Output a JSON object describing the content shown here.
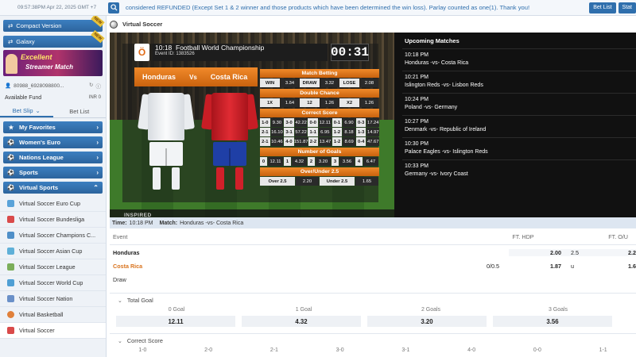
{
  "topbar": {
    "datetime": "09:57:38PM Apr 22, 2025 GMT +7",
    "announcement": "considered REFUNDED (Except Set 1 & 2 winner and those products which have been determined the win loss). Parlay counted as one(1). Thank you!",
    "bet_list_label": "Bet List",
    "stat_label": "Stat"
  },
  "sidebar": {
    "compact_label": "Compact Version",
    "new_badge": "NEW",
    "galaxy_label": "Galaxy",
    "banner_line1": "Excellent",
    "banner_line2": "Streamer Match",
    "account_id": "80988_6928098800...",
    "fund_label": "Available Fund",
    "fund_value": "INR 0",
    "tabs": [
      "Bet Slip",
      "Bet List"
    ],
    "categories": [
      {
        "label": "My Favorites",
        "icon": "star-icon"
      },
      {
        "label": "Women's Euro",
        "icon": "soccer-ball-icon"
      },
      {
        "label": "Nations League",
        "icon": "soccer-ball-icon"
      },
      {
        "label": "Sports",
        "icon": "soccer-ball-icon"
      },
      {
        "label": "Virtual Sports",
        "icon": "soccer-ball-icon"
      }
    ],
    "virtual_items": [
      "Virtual Soccer Euro Cup",
      "Virtual Soccer Bundesliga",
      "Virtual Soccer Champions C...",
      "Virtual Soccer Asian Cup",
      "Virtual Soccer League",
      "Virtual Soccer World Cup",
      "Virtual Soccer Nation",
      "Virtual Basketball",
      "Virtual Soccer"
    ]
  },
  "main": {
    "title": "Virtual Soccer",
    "board": {
      "logo": "Ö",
      "time": "10:18",
      "competition": "Football World Championship",
      "event_id": "Event ID: 1383526",
      "countdown": "00:31",
      "home": "Honduras",
      "vs": "Vs",
      "away": "Costa Rica",
      "inspired": "INSPIRED"
    },
    "match_betting": {
      "title": "Match Betting",
      "cells": [
        [
          "WIN",
          "3.34"
        ],
        [
          "DRAW",
          "3.32"
        ],
        [
          "LOSE",
          "2.08"
        ]
      ]
    },
    "double_chance": {
      "title": "Double Chance",
      "cells": [
        [
          "1X",
          "1.64"
        ],
        [
          "12",
          "1.26"
        ],
        [
          "X2",
          "1.26"
        ]
      ]
    },
    "correct_score": {
      "title": "Correct Score",
      "rows": [
        [
          [
            "1-0",
            "9.30"
          ],
          [
            "3-0",
            "42.22"
          ],
          [
            "0-0",
            "12.11"
          ],
          [
            "0-1",
            "6.90"
          ],
          [
            "0-3",
            "17.24"
          ]
        ],
        [
          [
            "2-1",
            "16.10"
          ],
          [
            "3-1",
            "57.22"
          ],
          [
            "1-1",
            "6.95"
          ],
          [
            "1-2",
            "8.18"
          ],
          [
            "1-3",
            "14.97"
          ]
        ],
        [
          [
            "2-1",
            "10.46"
          ],
          [
            "4-0",
            "151.87"
          ],
          [
            "2-2",
            "13.47"
          ],
          [
            "1-2",
            "8.69"
          ],
          [
            "0-4",
            "47.67"
          ]
        ]
      ]
    },
    "number_of_goals": {
      "title": "Number of Goals",
      "cells": [
        [
          "0",
          "12.11"
        ],
        [
          "1",
          "4.32"
        ],
        [
          "2",
          "3.20"
        ],
        [
          "3",
          "3.56"
        ],
        [
          "4",
          "6.47"
        ]
      ]
    },
    "over_under": {
      "title": "Over/Under 2.5",
      "cells": [
        [
          "Over 2.5",
          "2.20"
        ],
        [
          "Under 2.5",
          "1.65"
        ]
      ]
    },
    "upcoming_title": "Upcoming Matches",
    "upcoming": [
      {
        "time": "10:18 PM",
        "match": "Honduras -vs- Costa Rica"
      },
      {
        "time": "10:21 PM",
        "match": "Islington Reds -vs- Lisbon Reds"
      },
      {
        "time": "10:24 PM",
        "match": "Poland -vs- Germany"
      },
      {
        "time": "10:27 PM",
        "match": "Denmark -vs- Republic of Ireland"
      },
      {
        "time": "10:30 PM",
        "match": "Palace Eagles -vs- Islington Reds"
      },
      {
        "time": "10:33 PM",
        "match": "Germany -vs- Ivory Coast"
      }
    ],
    "matchbar": {
      "time_label": "Time:",
      "time_value": "10:18 PM",
      "match_label": "Match:",
      "match_value": "Honduras -vs- Costa Rica"
    },
    "table": {
      "event_label": "Event",
      "ft_hdp": "FT. HDP",
      "ft_ou": "FT. O/U",
      "rows": [
        {
          "name": "Honduras",
          "hdp": "",
          "hdp_odds": "2.00",
          "ou": "2.5",
          "ou_odds": "2.2"
        },
        {
          "name": "Costa Rica",
          "hdp": "0/0.5",
          "hdp_odds": "1.87",
          "ou": "u",
          "ou_odds": "1.6"
        },
        {
          "name": "Draw",
          "hdp": "",
          "hdp_odds": "",
          "ou": "",
          "ou_odds": ""
        }
      ]
    },
    "total_goal": {
      "title": "Total Goal",
      "labels": [
        "0 Goal",
        "1 Goal",
        "2 Goals",
        "3 Goals"
      ],
      "values": [
        "12.11",
        "4.32",
        "3.20",
        "3.56"
      ]
    },
    "correct_score_section": {
      "title": "Correct Score",
      "labels": [
        "1-0",
        "2-0",
        "2-1",
        "3-0",
        "3-1",
        "4-0",
        "0-0",
        "1-1"
      ]
    }
  },
  "colors": {
    "accent": "#2f6fad",
    "orange": "#d9741f"
  }
}
